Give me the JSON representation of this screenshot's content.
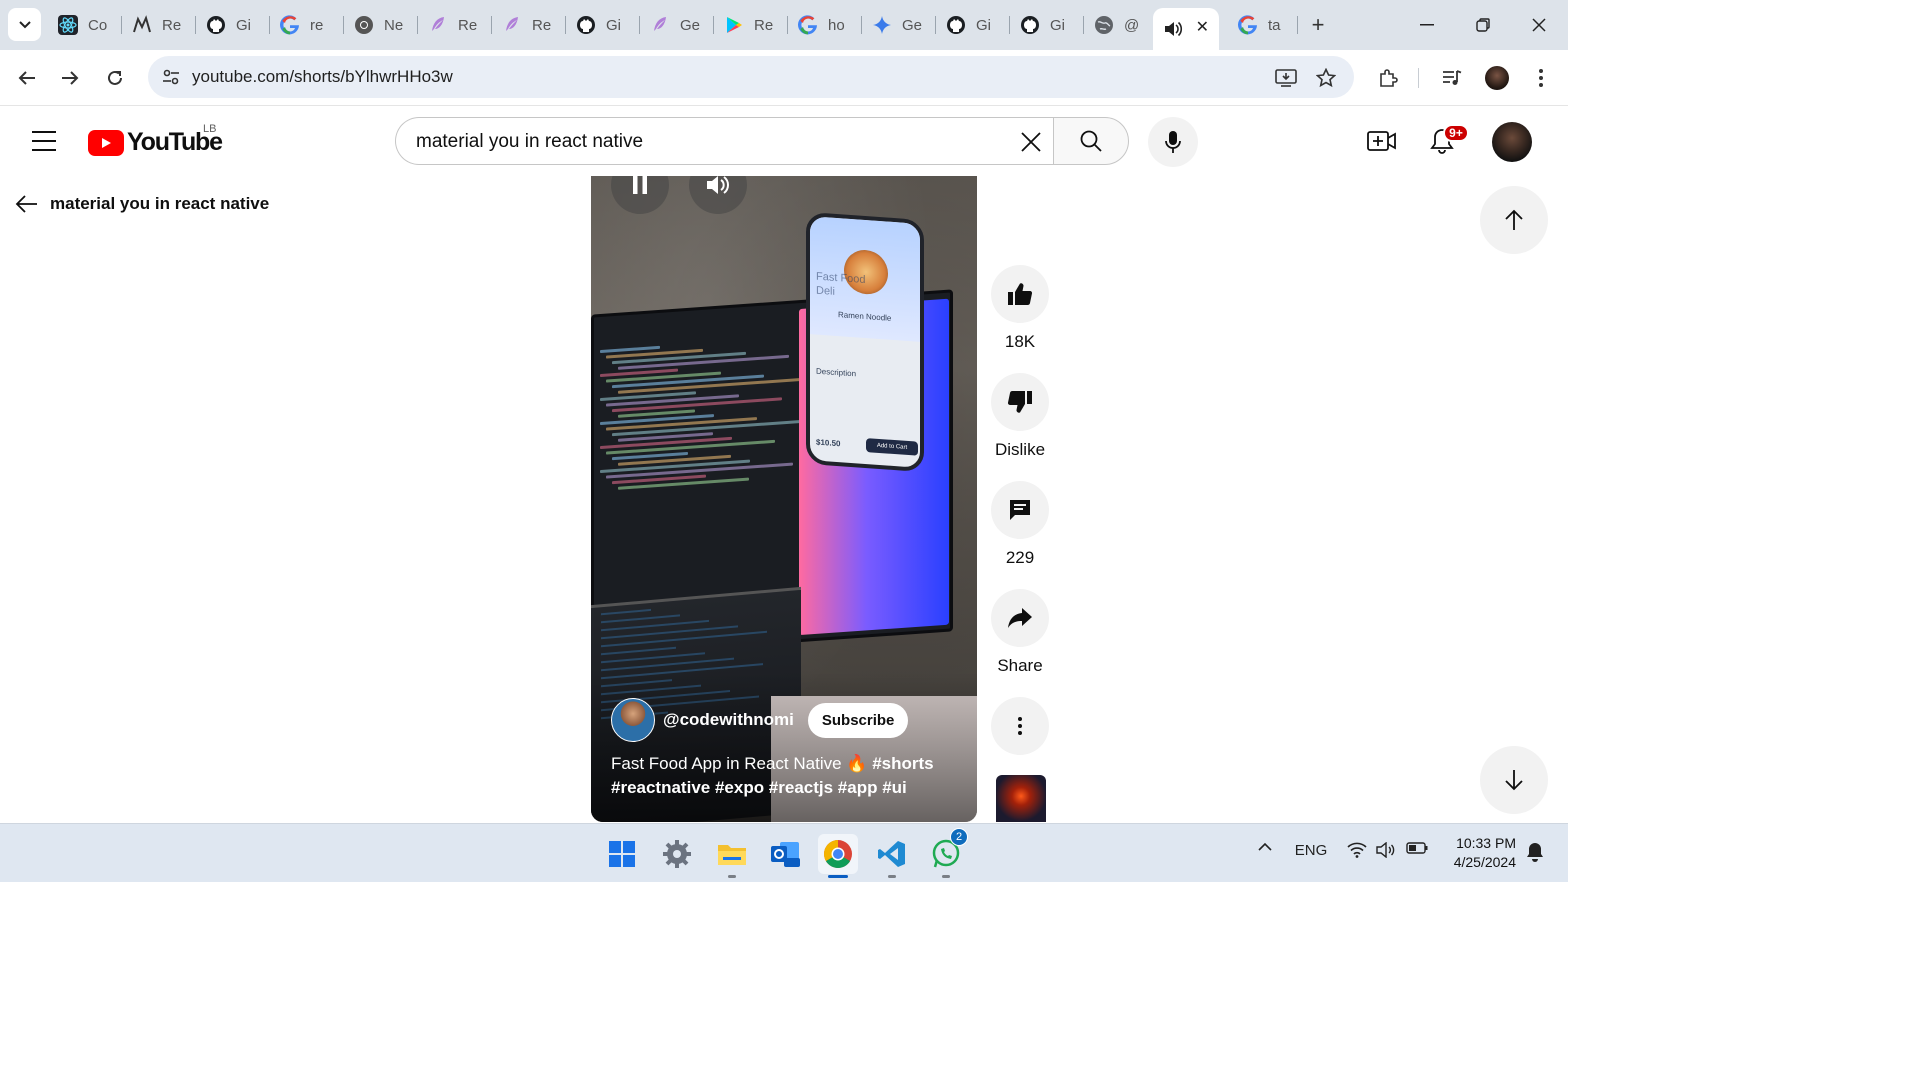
{
  "browser": {
    "tabs": [
      {
        "title": "Co",
        "icon": "react-icon"
      },
      {
        "title": "Re",
        "icon": "nestjs-icon"
      },
      {
        "title": "Gi",
        "icon": "github-icon"
      },
      {
        "title": "re",
        "icon": "google-icon"
      },
      {
        "title": "Ne",
        "icon": "chrome-icon"
      },
      {
        "title": "Re",
        "icon": "feather-icon"
      },
      {
        "title": "Re",
        "icon": "feather-icon"
      },
      {
        "title": "Gi",
        "icon": "github-icon"
      },
      {
        "title": "Ge",
        "icon": "feather-icon"
      },
      {
        "title": "Re",
        "icon": "play-store-icon"
      },
      {
        "title": "ho",
        "icon": "google-icon"
      },
      {
        "title": "Ge",
        "icon": "gemini-icon"
      },
      {
        "title": "Gi",
        "icon": "github-icon"
      },
      {
        "title": "Gi",
        "icon": "github-icon"
      },
      {
        "title": "@",
        "icon": "globe-icon"
      },
      {
        "title": "",
        "icon": "speaker-icon"
      },
      {
        "title": "ta",
        "icon": "google-icon"
      }
    ],
    "url": "youtube.com/shorts/bYlhwrHHo3w"
  },
  "youtube": {
    "logo_text": "YouTube",
    "region": "LB",
    "search_query": "material you in react native",
    "notification_count": "9+",
    "back_label": "material you in react native"
  },
  "short": {
    "channel": "@codewithnomi",
    "subscribe_label": "Subscribe",
    "title_plain": "Fast Food App in React Native",
    "title_emoji": "🔥",
    "title_tag1": "#shorts",
    "title_tags_line2": "#reactnative #expo #reactjs #app #ui",
    "phone_screen": {
      "headline": "Fast Food",
      "subhead": "Deli",
      "item": "Ramen Noodle",
      "section": "Description",
      "price": "$10.50",
      "cta": "Add to Cart"
    },
    "likes": "18K",
    "dislike_label": "Dislike",
    "comments": "229",
    "share_label": "Share"
  },
  "taskbar": {
    "language": "ENG",
    "time": "10:33 PM",
    "date": "4/25/2024",
    "whatsapp_badge": "2"
  },
  "colors": {
    "yt_red": "#ff0000",
    "chrome_tabstrip": "#dde3ea",
    "omnibox": "#e9eef6",
    "taskbar": "#dfe7f1"
  }
}
